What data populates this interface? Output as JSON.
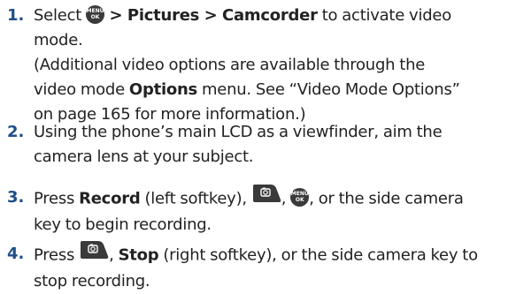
{
  "steps": [
    {
      "num": "1.",
      "l1_a": "Select ",
      "l1_icon": "menu-ok-key-icon",
      "l1_b": " > Pictures > Camcorder",
      "l1_c": " to activate video mode.",
      "l2": "(Additional video options are available through the",
      "l3_a": "video mode ",
      "l3_b": "Options",
      "l3_c": " menu. See “Video Mode Options”",
      "l4": "on page 165 for more information.)"
    },
    {
      "num": "2.",
      "l1": "Using the phone’s main LCD as a viewfinder, aim the",
      "l2": "camera lens at your subject."
    },
    {
      "num": "3.",
      "l1_a": "Press ",
      "l1_b": "Record",
      "l1_c": " (left softkey), ",
      "l1_icon1": "camera-key-icon",
      "l1_d": ", ",
      "l1_icon2": "menu-ok-key-icon",
      "l1_e": ", or the side camera",
      "l2": "key to begin recording."
    },
    {
      "num": "4.",
      "l1_a": "Press ",
      "l1_icon": "camera-key-icon",
      "l1_b": ", ",
      "l1_c": "Stop",
      "l1_d": " (right softkey), or the side camera key to",
      "l2": "stop recording."
    }
  ],
  "icons": {
    "menu_top": "MENU",
    "menu_bottom": "OK"
  },
  "colors": {
    "step_number": "#1f4f87",
    "body_text": "#222222",
    "icon_fill": "#3a3a3a"
  }
}
